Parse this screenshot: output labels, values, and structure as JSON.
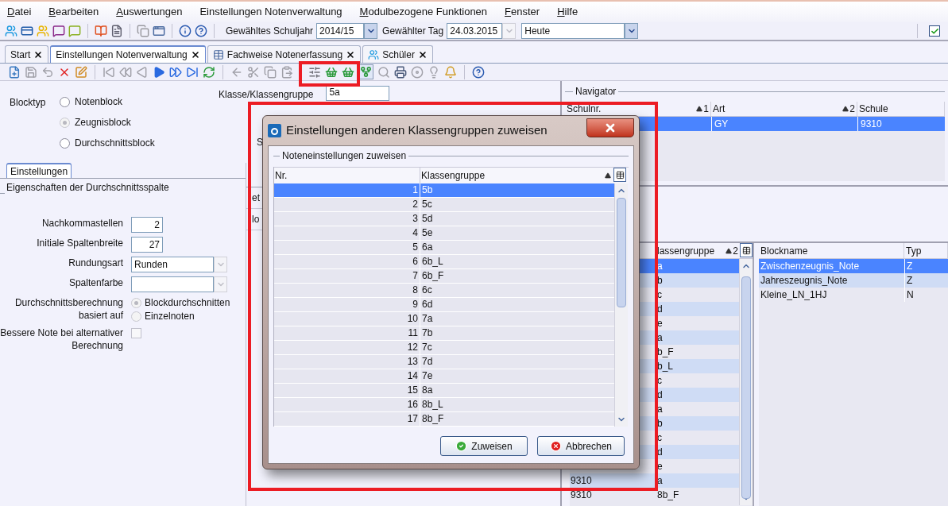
{
  "menu": [
    {
      "label": "Datei",
      "mnemonic": true
    },
    {
      "label": "Bearbeiten",
      "mnemonic": true
    },
    {
      "label": "Auswertungen",
      "mnemonic": true
    },
    {
      "label": "Einstellungen Notenverwaltung",
      "mnemonic": false
    },
    {
      "label": "Modulbezogene Funktionen",
      "mnemonic": true
    },
    {
      "label": "Fenster",
      "mnemonic": true
    },
    {
      "label": "Hilfe",
      "mnemonic": true
    }
  ],
  "toolbar": {
    "school_year_label": "Gewähltes Schuljahr",
    "school_year": "2014/15",
    "day_label": "Gewählter Tag",
    "day": "24.03.2015",
    "day_mode": "Heute",
    "checked": true
  },
  "tabs": [
    {
      "label": "Start",
      "selected": false,
      "kind": "plain"
    },
    {
      "label": "Einstellungen Notenverwaltung",
      "selected": true,
      "kind": "plain"
    },
    {
      "label": "Fachweise Notenerfassung",
      "selected": false,
      "kind": "table"
    },
    {
      "label": "Schüler",
      "selected": false,
      "kind": "people"
    }
  ],
  "form": {
    "blocktyp_label": "Blocktyp",
    "blocktyp_options": [
      {
        "label": "Notenblock",
        "selected": false,
        "disabled": false
      },
      {
        "label": "Zeugnisblock",
        "selected": true,
        "disabled": true
      },
      {
        "label": "Durchschnittsblock",
        "selected": false,
        "disabled": false
      }
    ],
    "klasse_label": "Klasse/Klassengruppe",
    "klasse": "5a",
    "cut_label": "S"
  },
  "settings_tab": "Einstellungen",
  "group_title": "Eigenschaften der Durchschnittsspalte",
  "fields": [
    {
      "kind": "number",
      "label": "Nachkommastellen",
      "value": "2"
    },
    {
      "kind": "number",
      "label": "Initiale Spaltenbreite",
      "value": "27"
    },
    {
      "kind": "select",
      "label": "Rundungsart",
      "value": "Runden"
    },
    {
      "kind": "select",
      "label": "Spaltenfarbe"
    },
    {
      "kind": "radio",
      "label": "Durchschnittsberechnung basiert auf",
      "options": [
        {
          "label": "Blockdurchschnitten",
          "selected": true
        },
        {
          "label": "Einzelnoten",
          "selected": false
        }
      ]
    },
    {
      "kind": "checkbox",
      "label": "Bessere Note bei alternativer Berechnung",
      "checked": false
    }
  ],
  "middle_labels": [
    "et",
    "lo"
  ],
  "navigator": {
    "title": "Navigator",
    "columns": [
      {
        "label": "Schulnr.",
        "sort": "1"
      },
      {
        "label": "Art",
        "sort": "2"
      },
      {
        "label": "Schule"
      }
    ],
    "rows": [
      {
        "art": "GY",
        "schule": "9310",
        "selected": true
      }
    ]
  },
  "groups_table": {
    "columns": [
      "lassengruppe"
    ],
    "sort": "2",
    "rows": [
      {
        "group": "a",
        "selected": true
      },
      {
        "group": "b",
        "selected": false
      },
      {
        "group": "c",
        "selected": false
      },
      {
        "group": "d",
        "selected": false
      },
      {
        "group": "e",
        "selected": false
      },
      {
        "group": "a",
        "selected": false
      },
      {
        "group": "b_F",
        "selected": false
      },
      {
        "group": "b_L",
        "selected": false
      },
      {
        "group": "c",
        "selected": false
      },
      {
        "group": "d",
        "selected": false
      },
      {
        "group": "a",
        "selected": false
      },
      {
        "group": "b",
        "selected": false
      },
      {
        "group": "c",
        "selected": false
      },
      {
        "group": "d",
        "selected": false
      },
      {
        "group": "e",
        "selected": false
      },
      {
        "schulnr": "9310",
        "group": "a",
        "selected": false
      },
      {
        "schulnr": "9310",
        "group": "8b_F",
        "selected": false
      }
    ]
  },
  "blocks_table": {
    "columns": [
      "Blockname",
      "Typ"
    ],
    "rows": [
      {
        "name": "Zwischenzeugnis_Note",
        "type": "Z",
        "selected": true
      },
      {
        "name": "Jahreszeugnis_Note",
        "type": "Z",
        "selected": false
      },
      {
        "name": "Kleine_LN_1HJ",
        "type": "N",
        "selected": false
      }
    ]
  },
  "dialog": {
    "title": "Einstellungen anderen Klassengruppen zuweisen",
    "group_title": "Noteneinstellungen zuweisen",
    "columns": [
      "Nr.",
      "Klassengruppe"
    ],
    "rows": [
      {
        "nr": "1",
        "group": "5b",
        "selected": true
      },
      {
        "nr": "2",
        "group": "5c",
        "selected": false
      },
      {
        "nr": "3",
        "group": "5d",
        "selected": false
      },
      {
        "nr": "4",
        "group": "5e",
        "selected": false
      },
      {
        "nr": "5",
        "group": "6a",
        "selected": false
      },
      {
        "nr": "6",
        "group": "6b_L",
        "selected": false
      },
      {
        "nr": "7",
        "group": "6b_F",
        "selected": false
      },
      {
        "nr": "8",
        "group": "6c",
        "selected": false
      },
      {
        "nr": "9",
        "group": "6d",
        "selected": false
      },
      {
        "nr": "10",
        "group": "7a",
        "selected": false
      },
      {
        "nr": "11",
        "group": "7b",
        "selected": false
      },
      {
        "nr": "12",
        "group": "7c",
        "selected": false
      },
      {
        "nr": "13",
        "group": "7d",
        "selected": false
      },
      {
        "nr": "14",
        "group": "7e",
        "selected": false
      },
      {
        "nr": "15",
        "group": "8a",
        "selected": false
      },
      {
        "nr": "16",
        "group": "8b_L",
        "selected": false
      },
      {
        "nr": "17",
        "group": "8b_F",
        "selected": false
      }
    ],
    "buttons": [
      {
        "label": "Zuweisen",
        "kind": "ok"
      },
      {
        "label": "Abbrechen",
        "kind": "cancel"
      }
    ]
  }
}
